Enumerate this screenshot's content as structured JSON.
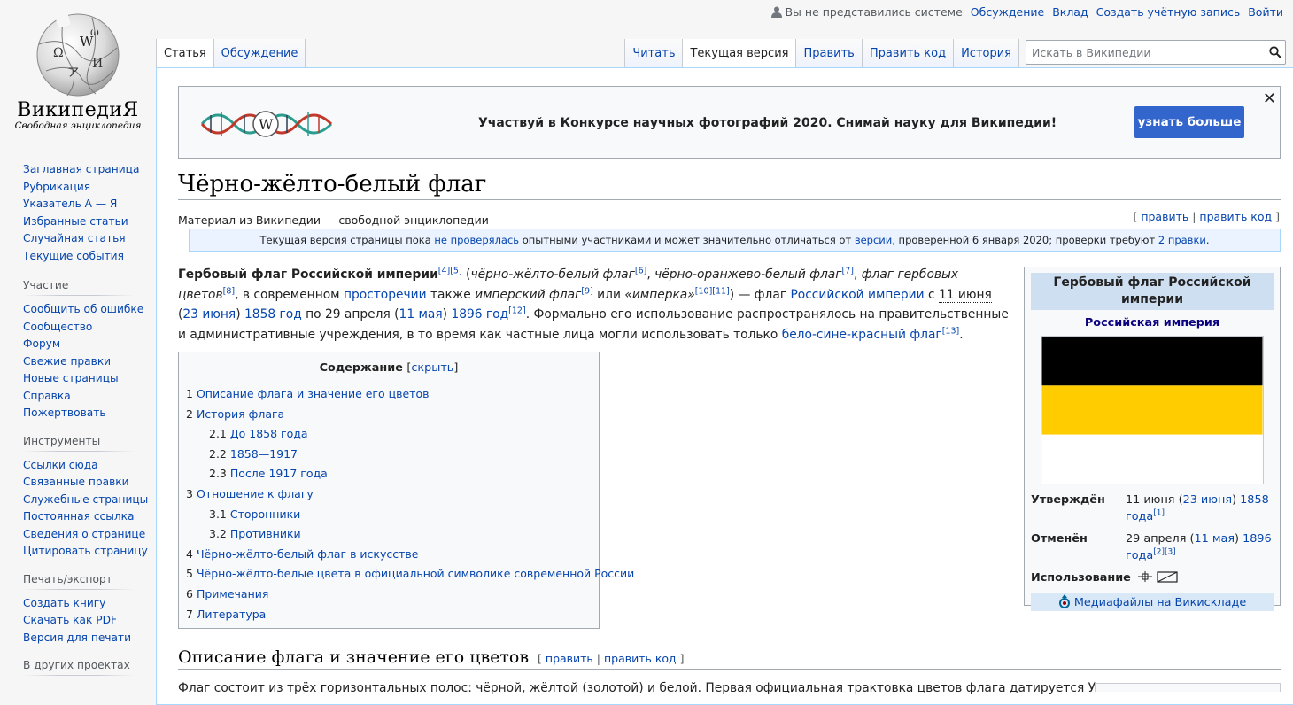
{
  "logo": {
    "wordmark": "ВикипедиЯ",
    "tagline": "Свободная энциклопедия"
  },
  "personal": {
    "anon": "Вы не представились системе",
    "links": [
      "Обсуждение",
      "Вклад",
      "Создать учётную запись",
      "Войти"
    ]
  },
  "tabs": {
    "left": [
      {
        "label": "Статья",
        "selected": true
      },
      {
        "label": "Обсуждение"
      }
    ],
    "right": [
      {
        "label": "Читать"
      },
      {
        "label": "Текущая версия",
        "selected": true
      },
      {
        "label": "Править"
      },
      {
        "label": "Править код"
      },
      {
        "label": "История"
      }
    ]
  },
  "search": {
    "placeholder": "Искать в Википедии"
  },
  "sidebar": {
    "nav": [
      "Заглавная страница",
      "Рубрикация",
      "Указатель А — Я",
      "Избранные статьи",
      "Случайная статья",
      "Текущие события"
    ],
    "participation": {
      "title": "Участие",
      "items": [
        "Сообщить об ошибке",
        "Сообщество",
        "Форум",
        "Свежие правки",
        "Новые страницы",
        "Справка",
        "Пожертвовать"
      ]
    },
    "tools": {
      "title": "Инструменты",
      "items": [
        "Ссылки сюда",
        "Связанные правки",
        "Служебные страницы",
        "Постоянная ссылка",
        "Сведения о странице",
        "Цитировать страницу"
      ]
    },
    "print": {
      "title": "Печать/экспорт",
      "items": [
        "Создать книгу",
        "Скачать как PDF",
        "Версия для печати"
      ]
    },
    "other": {
      "title": "В других проектах"
    }
  },
  "banner": {
    "text": "Участвуй в Конкурсе научных фотографий 2020. Снимай науку для Википедии!",
    "button": "узнать больше",
    "close": "✕"
  },
  "page": {
    "title": "Чёрно-жёлто-белый флаг",
    "sitesub": "Материал из Википедии — свободной энциклопедии",
    "edit_links": [
      "править",
      "править код"
    ]
  },
  "review": {
    "t1": "Текущая версия страницы пока ",
    "l1": "не проверялась",
    "t2": " опытными участниками и может значительно отличаться от ",
    "l2": "версии",
    "t3": ", проверенной 6 января 2020; проверки требуют ",
    "l3": "2 правки",
    "t4": "."
  },
  "lead": {
    "b1": "Гербовый флаг Российской империи",
    "r1": "[4][5]",
    "t1": " (",
    "i1": "чёрно-жёлто-белый флаг",
    "r2": "[6]",
    "t2": ", ",
    "i2": "чёрно-оранжево-белый флаг",
    "r3": "[7]",
    "t3": ", ",
    "i3": "флаг гербовых цветов",
    "r4": "[8]",
    "t4": ", в современном ",
    "l1": "просторечии",
    "t5": " также ",
    "i4": "имперский флаг",
    "r5": "[9]",
    "t6": " или ",
    "i5": "«имперка»",
    "r6": "[10][11]",
    "t7": ") — флаг ",
    "l2": "Российской империи",
    "t8": " с ",
    "a1": "11 июня",
    "t9": " (",
    "l3": "23 июня",
    "t10": ") ",
    "l4": "1858 год",
    "t11": " по ",
    "a2": "29 апреля",
    "t12": " (",
    "l5": "11 мая",
    "t13": ") ",
    "l6": "1896 год",
    "r7": "[12]",
    "t14": ". Формально его использование распространялось на правительственные и административные учреждения, в то время как частные лица могли использовать только ",
    "l7": "бело-сине-красный флаг",
    "r8": "[13]",
    "t15": "."
  },
  "toc": {
    "title": "Содержание",
    "toggle": "скрыть",
    "items": [
      {
        "num": "1",
        "text": "Описание флага и значение его цветов"
      },
      {
        "num": "2",
        "text": "История флага"
      },
      {
        "num": "2.1",
        "text": "До 1858 года",
        "sub": true
      },
      {
        "num": "2.2",
        "text": "1858—1917",
        "sub": true
      },
      {
        "num": "2.3",
        "text": "После 1917 года",
        "sub": true
      },
      {
        "num": "3",
        "text": "Отношение к флагу"
      },
      {
        "num": "3.1",
        "text": "Сторонники",
        "sub": true
      },
      {
        "num": "3.2",
        "text": "Противники",
        "sub": true
      },
      {
        "num": "4",
        "text": "Чёрно-жёлто-белый флаг в искусстве"
      },
      {
        "num": "5",
        "text": "Чёрно-жёлто-белые цвета в официальной символике современной России"
      },
      {
        "num": "6",
        "text": "Примечания"
      },
      {
        "num": "7",
        "text": "Литература"
      }
    ]
  },
  "infobox": {
    "title": "Гербовый флаг Российской империи",
    "subtitle": "Российская империя",
    "flag_colors": [
      "#000000",
      "#ffcc00",
      "#ffffff"
    ],
    "approved": {
      "label": "Утверждён",
      "date": "11 июня",
      "t1": " (",
      "link1": "23 июня",
      "t2": ") ",
      "link2": "1858 года",
      "ref": "[1]"
    },
    "cancelled": {
      "label": "Отменён",
      "date": "29 апреля",
      "t1": " (",
      "link1": "11 мая",
      "t2": ") ",
      "link2": "1896 года",
      "ref": "[2][3]"
    },
    "usage": {
      "label": "Использование"
    },
    "commons": "Медиафайлы на Викискладе"
  },
  "section": {
    "title": "Описание флага и значение его цветов",
    "edit1": "править",
    "edit2": "править код",
    "next_text": "Флаг состоит из трёх горизонтальных полос: чёрной, жёлтой (золотой) и белой. Первая официальная трактовка цветов флага датируется Указом"
  },
  "colors": {
    "link": "#0645ad",
    "banner_button": "#3366cc",
    "infobox_header": "#cedff2"
  }
}
